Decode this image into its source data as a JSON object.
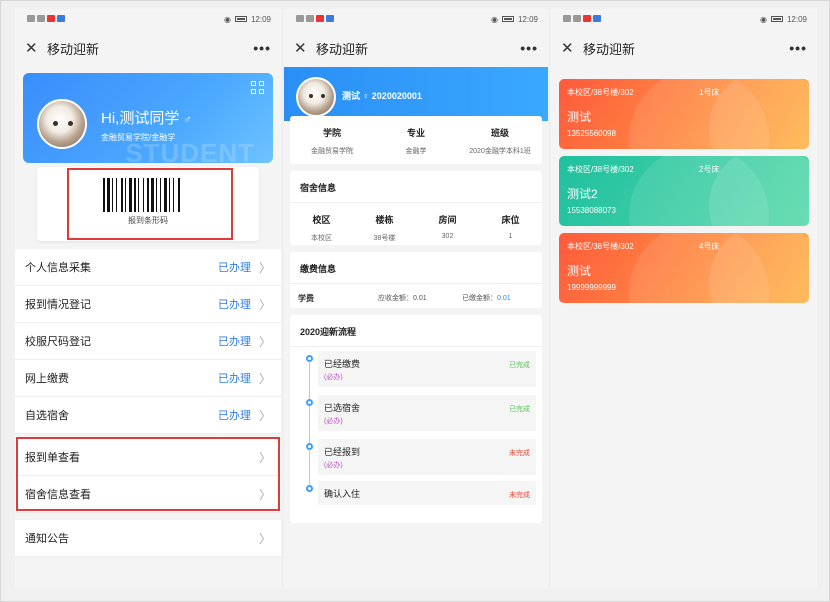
{
  "app_title": "移动迎新",
  "more_label": "•••",
  "close_label": "✕",
  "status_time": "12:09",
  "panel1": {
    "greeting": "Hi,测试同学",
    "gender_symbol": "♂",
    "school": "金融贸易学院/金融学",
    "watermark": "STUDENT",
    "barcode_caption": "报到条形码",
    "menu": [
      {
        "label": "个人信息采集",
        "status": "已办理"
      },
      {
        "label": "报到情况登记",
        "status": "已办理"
      },
      {
        "label": "校服尺码登记",
        "status": "已办理"
      },
      {
        "label": "网上缴费",
        "status": "已办理"
      },
      {
        "label": "自选宿舍",
        "status": "已办理"
      }
    ],
    "links": [
      {
        "label": "报到单查看"
      },
      {
        "label": "宿舍信息查看"
      }
    ],
    "notice": {
      "label": "通知公告"
    }
  },
  "panel2": {
    "student_name": "测试",
    "gender_symbol": "♀",
    "student_id": "2020020001",
    "info": [
      {
        "h": "学院",
        "v": "金融贸易学院"
      },
      {
        "h": "专业",
        "v": "金融学"
      },
      {
        "h": "班级",
        "v": "2020金融学本科1班"
      }
    ],
    "dorm_title": "宿舍信息",
    "dorm": [
      {
        "h": "校区",
        "v": "本校区"
      },
      {
        "h": "楼栋",
        "v": "38号楼"
      },
      {
        "h": "房间",
        "v": "302"
      },
      {
        "h": "床位",
        "v": "1"
      }
    ],
    "fee_title": "缴费信息",
    "fee_item": "学费",
    "fee_due_label": "应收金额：",
    "fee_due": "0.01",
    "fee_paid_label": "已缴金额：",
    "fee_paid": "0.01",
    "flow_title": "2020迎新流程",
    "flow": [
      {
        "title": "已经缴费",
        "req": "(必办)",
        "status": "已完成",
        "color": "#5cc15c"
      },
      {
        "title": "已选宿舍",
        "req": "(必办)",
        "status": "已完成",
        "color": "#5cc15c"
      },
      {
        "title": "已经报到",
        "req": "(必办)",
        "status": "未完成",
        "color": "#e64a3b"
      },
      {
        "title": "确认入住",
        "req": "",
        "status": "未完成",
        "color": "#e64a3b"
      }
    ]
  },
  "panel3": {
    "rooms": [
      {
        "loc": "本校区/38号楼/302",
        "bed": "1号床",
        "name": "测试",
        "phone": "13525560098",
        "color_from": "#ff5a3c",
        "color_to": "#ffb347"
      },
      {
        "loc": "本校区/38号楼/302",
        "bed": "2号床",
        "name": "测试2",
        "phone": "15538088073",
        "color_from": "#20c0a0",
        "color_to": "#55d8a8"
      },
      {
        "loc": "本校区/38号楼/302",
        "bed": "4号床",
        "name": "测试",
        "phone": "19999999999",
        "color_from": "#ff5a3c",
        "color_to": "#ffb347"
      }
    ]
  }
}
